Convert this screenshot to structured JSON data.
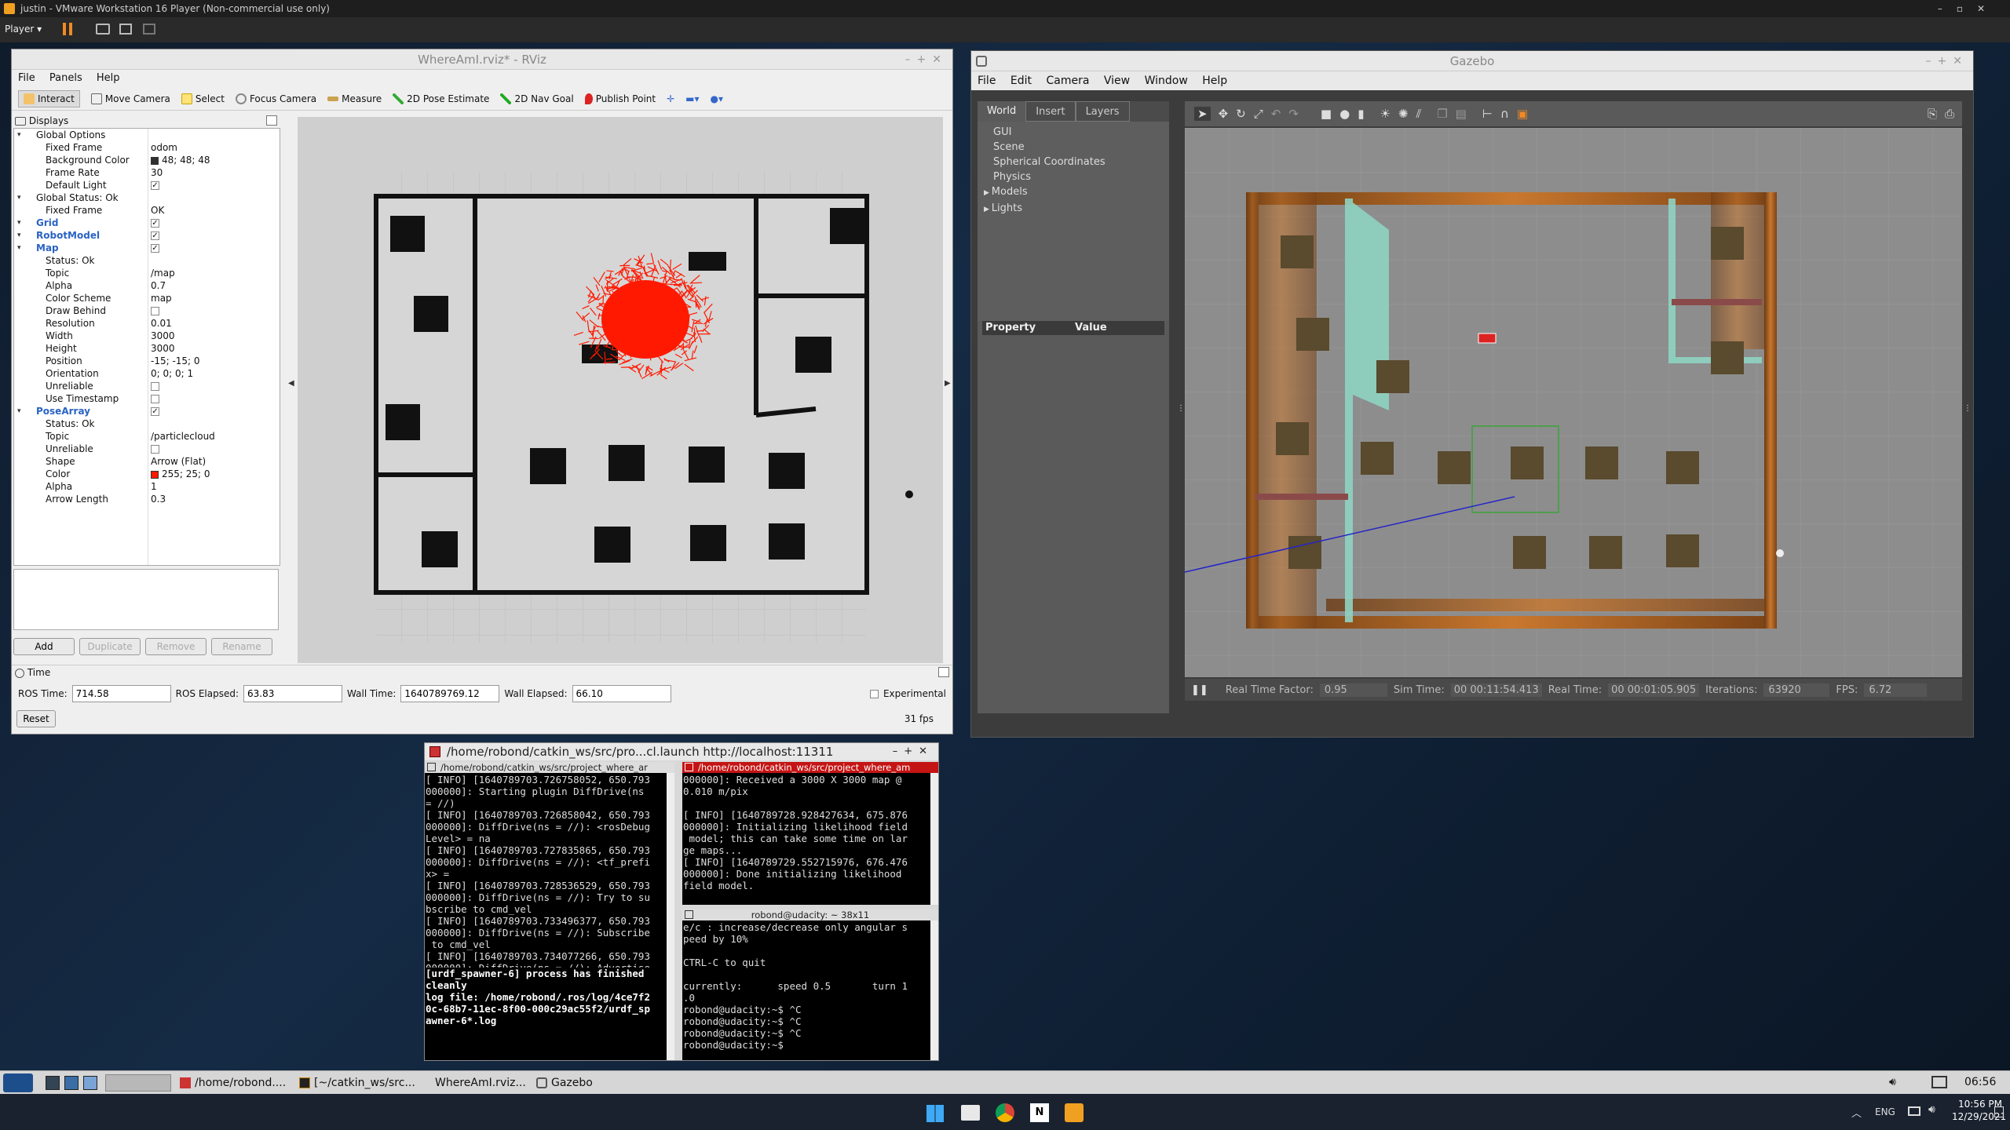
{
  "vm": {
    "title": "justin - VMware Workstation 16 Player (Non-commercial use only)",
    "player_label": "Player"
  },
  "rviz": {
    "title": "WhereAmI.rviz* - RViz",
    "menu": [
      "File",
      "Panels",
      "Help"
    ],
    "tools": [
      "Interact",
      "Move Camera",
      "Select",
      "Focus Camera",
      "Measure",
      "2D Pose Estimate",
      "2D Nav Goal",
      "Publish Point"
    ],
    "displays_title": "Displays",
    "properties": [
      {
        "indent": 0,
        "label": "Global Options",
        "value": "",
        "bold": false
      },
      {
        "indent": 1,
        "label": "Fixed Frame",
        "value": "odom"
      },
      {
        "indent": 1,
        "label": "Background Color",
        "value": "48; 48; 48",
        "swatch": "#303030"
      },
      {
        "indent": 1,
        "label": "Frame Rate",
        "value": "30"
      },
      {
        "indent": 1,
        "label": "Default Light",
        "value": "",
        "check": "✓"
      },
      {
        "indent": 0,
        "label": "Global Status: Ok",
        "value": ""
      },
      {
        "indent": 1,
        "label": "Fixed Frame",
        "value": "OK"
      },
      {
        "indent": 0,
        "label": "Grid",
        "value": "",
        "check": "✓",
        "blue": true
      },
      {
        "indent": 0,
        "label": "RobotModel",
        "value": "",
        "check": "✓",
        "blue": true
      },
      {
        "indent": 0,
        "label": "Map",
        "value": "",
        "check": "✓",
        "blue": true
      },
      {
        "indent": 1,
        "label": "Status: Ok",
        "value": ""
      },
      {
        "indent": 1,
        "label": "Topic",
        "value": "/map"
      },
      {
        "indent": 1,
        "label": "Alpha",
        "value": "0.7"
      },
      {
        "indent": 1,
        "label": "Color Scheme",
        "value": "map"
      },
      {
        "indent": 1,
        "label": "Draw Behind",
        "value": "",
        "check": " "
      },
      {
        "indent": 1,
        "label": "Resolution",
        "value": "0.01"
      },
      {
        "indent": 1,
        "label": "Width",
        "value": "3000"
      },
      {
        "indent": 1,
        "label": "Height",
        "value": "3000"
      },
      {
        "indent": 1,
        "label": "Position",
        "value": "-15; -15; 0"
      },
      {
        "indent": 1,
        "label": "Orientation",
        "value": "0; 0; 0; 1"
      },
      {
        "indent": 1,
        "label": "Unreliable",
        "value": "",
        "check": " "
      },
      {
        "indent": 1,
        "label": "Use Timestamp",
        "value": "",
        "check": " "
      },
      {
        "indent": 0,
        "label": "PoseArray",
        "value": "",
        "check": "✓",
        "blue": true
      },
      {
        "indent": 1,
        "label": "Status: Ok",
        "value": ""
      },
      {
        "indent": 1,
        "label": "Topic",
        "value": "/particlecloud"
      },
      {
        "indent": 1,
        "label": "Unreliable",
        "value": "",
        "check": " "
      },
      {
        "indent": 1,
        "label": "Shape",
        "value": "Arrow (Flat)"
      },
      {
        "indent": 1,
        "label": "Color",
        "value": "255; 25; 0",
        "swatch": "#ff1900"
      },
      {
        "indent": 1,
        "label": "Alpha",
        "value": "1"
      },
      {
        "indent": 1,
        "label": "Arrow Length",
        "value": "0.3"
      }
    ],
    "buttons": {
      "add": "Add",
      "duplicate": "Duplicate",
      "remove": "Remove",
      "rename": "Rename"
    },
    "time": {
      "panel_title": "Time",
      "ros_time_label": "ROS Time:",
      "ros_time": "714.58",
      "ros_elapsed_label": "ROS Elapsed:",
      "ros_elapsed": "63.83",
      "wall_time_label": "Wall Time:",
      "wall_time": "1640789769.12",
      "wall_elapsed_label": "Wall Elapsed:",
      "wall_elapsed": "66.10",
      "experimental": "Experimental",
      "reset": "Reset",
      "fps": "31 fps"
    }
  },
  "gazebo": {
    "title": "Gazebo",
    "menu": [
      "File",
      "Edit",
      "Camera",
      "View",
      "Window",
      "Help"
    ],
    "tabs": [
      "World",
      "Insert",
      "Layers"
    ],
    "tree": [
      "GUI",
      "Scene",
      "Spherical Coordinates",
      "Physics",
      "Models",
      "Lights"
    ],
    "prop_header": {
      "property": "Property",
      "value": "Value"
    },
    "status": {
      "rtf_label": "Real Time Factor:",
      "rtf": "0.95",
      "sim_label": "Sim Time:",
      "sim": "00 00:11:54.413",
      "real_label": "Real Time:",
      "real": "00 00:01:05.905",
      "iter_label": "Iterations:",
      "iter": "63920",
      "fps_label": "FPS:",
      "fps": "6.72"
    }
  },
  "terminal": {
    "title": "/home/robond/catkin_ws/src/pro...cl.launch http://localhost:11311",
    "tab_left": "/home/robond/catkin_ws/src/project_where_ar",
    "tab_right": "/home/robond/catkin_ws/src/project_where_am",
    "left_text": "[ INFO] [1640789703.726758052, 650.793\n000000]: Starting plugin DiffDrive(ns\n= //)\n[ INFO] [1640789703.726858042, 650.793\n000000]: DiffDrive(ns = //): <rosDebug\nLevel> = na\n[ INFO] [1640789703.727835865, 650.793\n000000]: DiffDrive(ns = //): <tf_prefi\nx> =\n[ INFO] [1640789703.728536529, 650.793\n000000]: DiffDrive(ns = //): Try to su\nbscribe to cmd_vel\n[ INFO] [1640789703.733496377, 650.793\n000000]: DiffDrive(ns = //): Subscribe\n to cmd_vel\n[ INFO] [1640789703.734077266, 650.793\n000000]: DiffDrive(ns = //): Advertise\n odom on odom",
    "left_bold": "[urdf_spawner-6] process has finished\ncleanly\nlog file: /home/robond/.ros/log/4ce7f2\n0c-68b7-11ec-8f00-000c29ac55f2/urdf_sp\nawner-6*.log",
    "right_top": "000000]: Received a 3000 X 3000 map @\n0.010 m/pix\n\n[ INFO] [1640789728.928427634, 675.876\n000000]: Initializing likelihood field\n model; this can take some time on lar\nge maps...\n[ INFO] [1640789729.552715976, 676.476\n000000]: Done initializing likelihood\nfield model.",
    "right_bottom_title": "robond@udacity: ~ 38x11",
    "right_bottom": "e/c : increase/decrease only angular s\npeed by 10%\n\nCTRL-C to quit\n\ncurrently:      speed 0.5       turn 1\n.0\nrobond@udacity:~$ ^C\nrobond@udacity:~$ ^C\nrobond@udacity:~$ ^C\nrobond@udacity:~$ "
  },
  "guest_taskbar": {
    "items": [
      "/home/robond....",
      "[~/catkin_ws/src...",
      "WhereAmI.rviz...",
      "Gazebo"
    ],
    "clock": "06:56"
  },
  "host_taskbar": {
    "lang": "ENG",
    "time": "10:56 PM",
    "date": "12/29/2021"
  }
}
